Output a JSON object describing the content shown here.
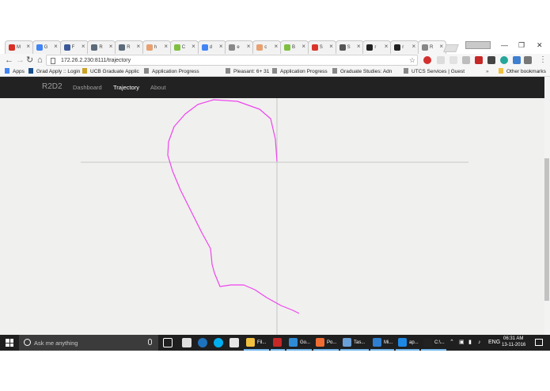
{
  "browser": {
    "user_badge": "",
    "tabs": [
      {
        "title": "M",
        "favicon": "gmail-icon",
        "color": "#d93025"
      },
      {
        "title": "G",
        "favicon": "google-icon",
        "color": "#4285f4"
      },
      {
        "title": "F",
        "favicon": "facebook-icon",
        "color": "#3b5998"
      },
      {
        "title": "R",
        "favicon": "page-icon",
        "color": "#5b6b7b"
      },
      {
        "title": "R",
        "favicon": "page-icon",
        "color": "#5b6b7b"
      },
      {
        "title": "h",
        "favicon": "fire-icon",
        "color": "#e8a070"
      },
      {
        "title": "C",
        "favicon": "generic-icon",
        "color": "#7fbf3f"
      },
      {
        "title": "d",
        "favicon": "google-icon",
        "color": "#4285f4"
      },
      {
        "title": "e",
        "favicon": "page-icon",
        "color": "#888888"
      },
      {
        "title": "c",
        "favicon": "fire-icon",
        "color": "#e8a070"
      },
      {
        "title": "B",
        "favicon": "generic-icon",
        "color": "#7fbf3f"
      },
      {
        "title": "S",
        "favicon": "pdf-icon",
        "color": "#d9342b"
      },
      {
        "title": "S",
        "favicon": "cloud-icon",
        "color": "#555555"
      },
      {
        "title": "r",
        "favicon": "github-icon",
        "color": "#222222"
      },
      {
        "title": "r",
        "favicon": "github-icon",
        "color": "#222222"
      },
      {
        "title": "R",
        "favicon": "page-icon",
        "color": "#888888"
      }
    ],
    "url": "172.26.2.230:8111/trajectory",
    "bookmarks": [
      {
        "label": "Apps",
        "icon": "apps-icon",
        "color": "#4285f4"
      },
      {
        "label": "Grad Apply :: Login",
        "icon": "graduation-cap-icon",
        "color": "#1a4e8c"
      },
      {
        "label": "UCB Graduate Applic",
        "icon": "seal-icon",
        "color": "#c9a227"
      },
      {
        "label": "Application Progress",
        "icon": "page-icon",
        "color": "#888888"
      },
      {
        "label": "Pleasant: 6+ 31",
        "icon": "page-icon",
        "color": "#888888"
      },
      {
        "label": "Application Progress",
        "icon": "page-icon",
        "color": "#888888"
      },
      {
        "label": "Graduate Studies: Adn",
        "icon": "page-icon",
        "color": "#888888"
      },
      {
        "label": "UTCS Services | Guest",
        "icon": "page-icon",
        "color": "#888888"
      }
    ],
    "bookmarks_overflow": "»",
    "other_bookmarks": "Other bookmarks"
  },
  "app": {
    "brand": "R2D2",
    "nav": [
      {
        "label": "Dashboard"
      },
      {
        "label": "Trajectory"
      },
      {
        "label": "About"
      }
    ],
    "trajectory_color": "#ee44ee",
    "axis_color": "#bbbbbb"
  },
  "taskbar": {
    "search_placeholder": "Ask me anything",
    "apps": [
      {
        "label": "Fil...",
        "icon": "file-explorer-icon",
        "color": "#f0c040"
      },
      {
        "label": "",
        "icon": "acrobat-icon",
        "color": "#c62828"
      },
      {
        "label": "Go...",
        "icon": "chrome-icon",
        "color": "#2e8bd6"
      },
      {
        "label": "Po...",
        "icon": "postman-icon",
        "color": "#ef6c33"
      },
      {
        "label": "Tas...",
        "icon": "task-manager-icon",
        "color": "#6aa0d8"
      },
      {
        "label": "Mi...",
        "icon": "matlab-icon",
        "color": "#2f7fd1"
      },
      {
        "label": "ap...",
        "icon": "vscode-icon",
        "color": "#1e88e5"
      },
      {
        "label": "C:\\...",
        "icon": "cmd-icon",
        "color": "#222222"
      }
    ],
    "lang": "ENG",
    "time": "06:31 AM",
    "date": "13-11-2016"
  }
}
